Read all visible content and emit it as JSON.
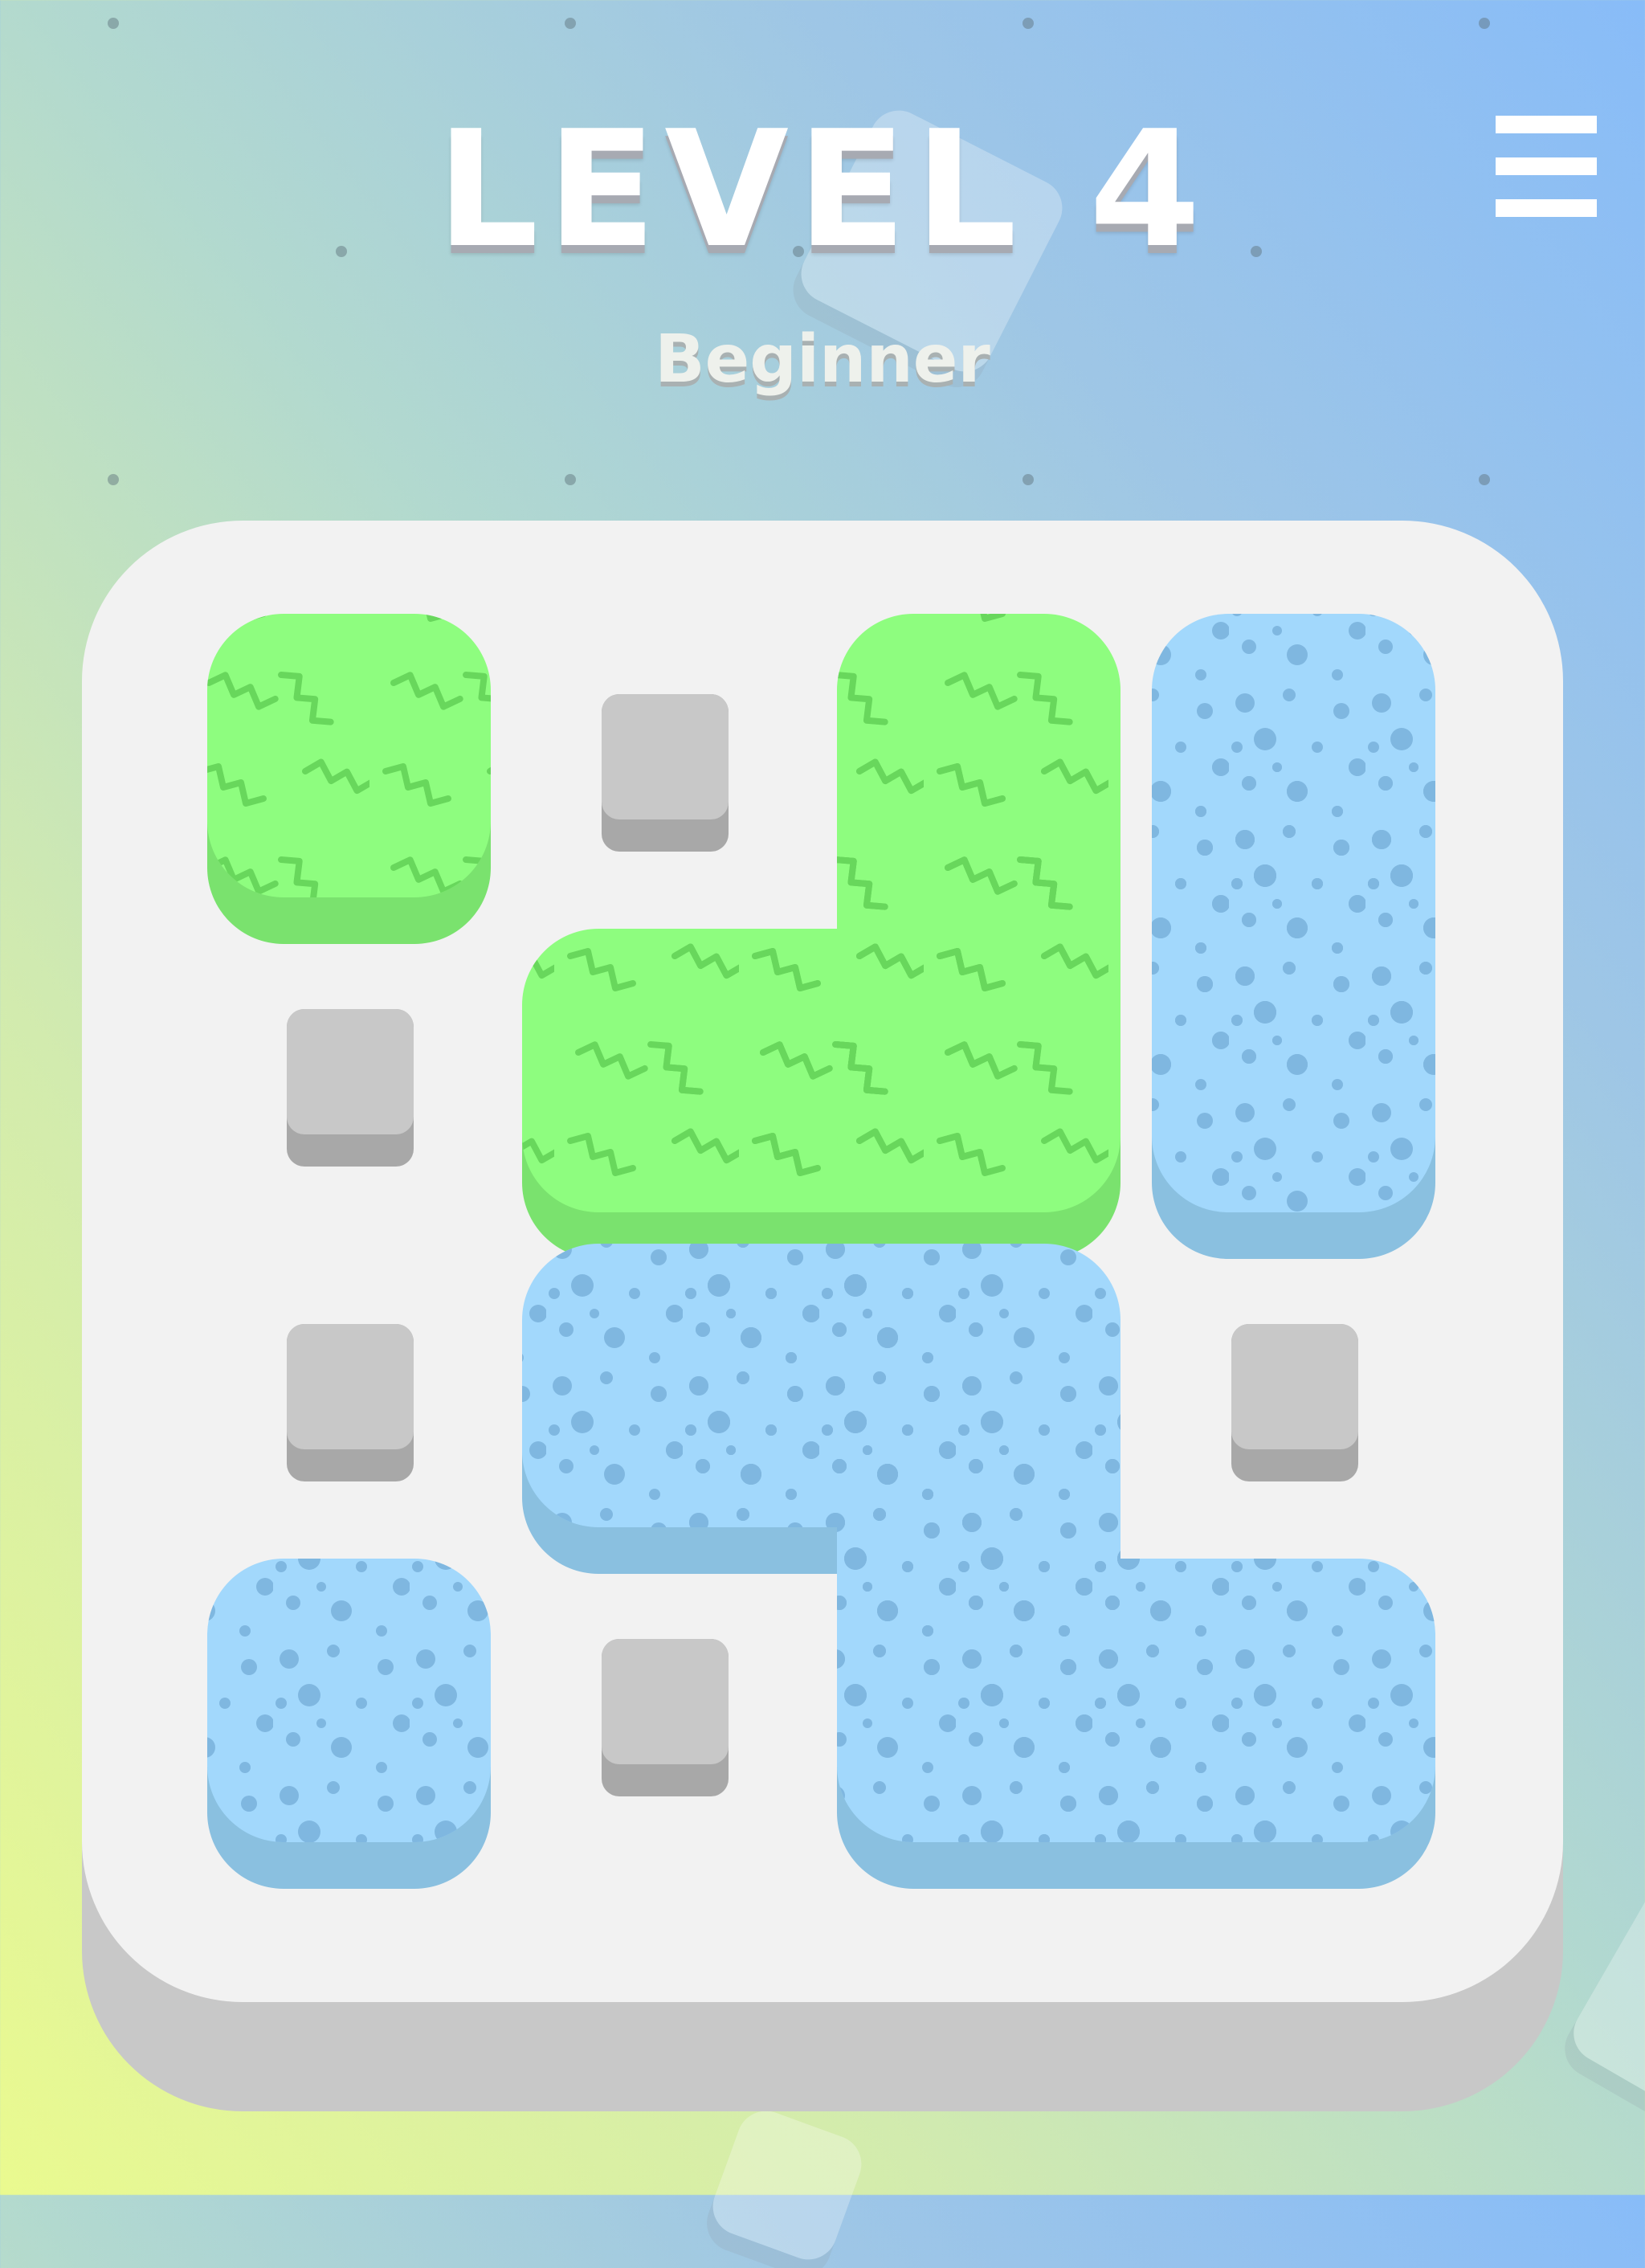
{
  "header": {
    "level_title": "LEVEL 4",
    "difficulty": "Beginner"
  },
  "menu": {
    "icon": "hamburger-menu-icon"
  },
  "colors": {
    "green_top": "#8efd7f",
    "green_side": "#7ae26e",
    "green_pattern": "#68d75c",
    "blue_top": "#a2d8fc",
    "blue_side": "#8ac0e0",
    "blue_pattern": "#7fb7e0",
    "board": "#f2f2f2",
    "board_edge": "#c8c8c8",
    "peg_top": "#c8c8c8",
    "peg_side": "#a8a8a8"
  },
  "grid": {
    "rows": 4,
    "cols": 4,
    "pieces": [
      {
        "id": "green-piece-1",
        "color": "green",
        "cells": [
          [
            0,
            0
          ]
        ]
      },
      {
        "id": "green-piece-2",
        "color": "green",
        "cells": [
          [
            0,
            2
          ],
          [
            1,
            1
          ],
          [
            1,
            2
          ]
        ]
      },
      {
        "id": "blue-piece-1",
        "color": "blue",
        "cells": [
          [
            0,
            3
          ],
          [
            1,
            3
          ]
        ]
      },
      {
        "id": "blue-piece-2",
        "color": "blue",
        "cells": [
          [
            2,
            1
          ],
          [
            2,
            2
          ],
          [
            3,
            2
          ],
          [
            3,
            3
          ]
        ]
      },
      {
        "id": "blue-piece-3",
        "color": "blue",
        "cells": [
          [
            3,
            0
          ]
        ]
      }
    ],
    "pegs": [
      [
        0,
        1
      ],
      [
        1,
        0
      ],
      [
        2,
        0
      ],
      [
        2,
        3
      ],
      [
        3,
        1
      ]
    ]
  }
}
